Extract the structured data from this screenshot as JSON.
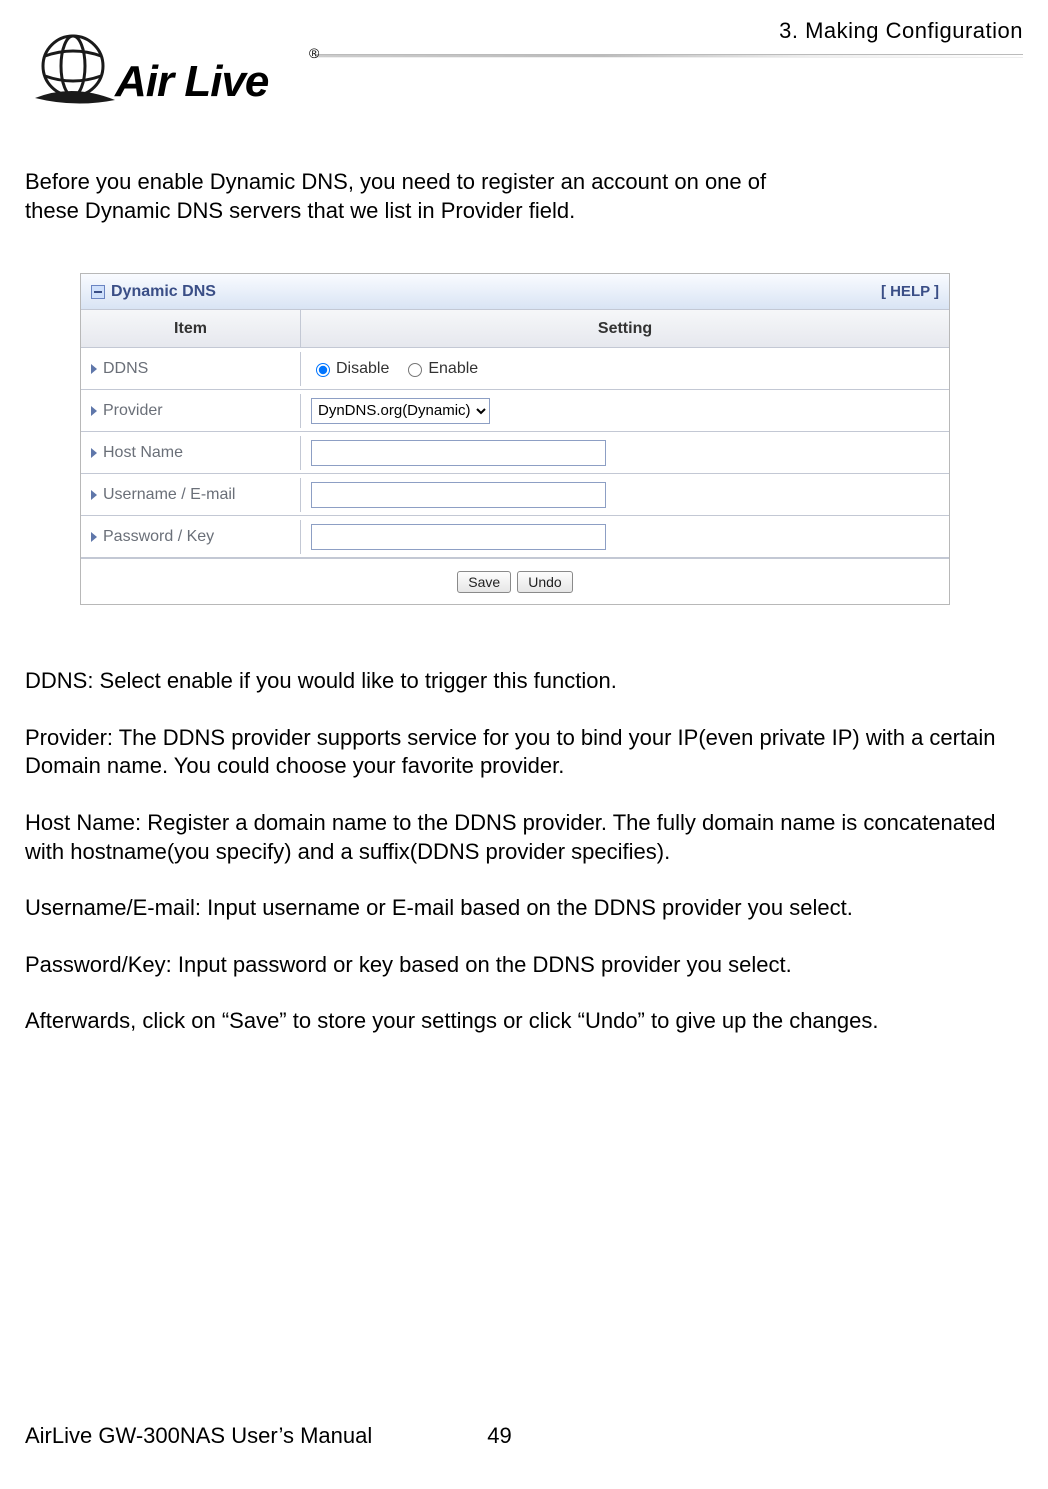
{
  "header": {
    "chapter": "3.  Making  Configuration",
    "brand_name": "Air Live",
    "brand_registered": "®"
  },
  "intro": "Before you enable Dynamic DNS, you need to register an account on one of these Dynamic DNS servers that we list in Provider field.",
  "panel": {
    "title": "Dynamic DNS",
    "help": "[ HELP ]",
    "col_item": "Item",
    "col_setting": "Setting",
    "rows": {
      "ddns_label": "DDNS",
      "ddns_disable": "Disable",
      "ddns_enable": "Enable",
      "provider_label": "Provider",
      "provider_value": "DynDNS.org(Dynamic)",
      "hostname_label": "Host Name",
      "hostname_value": "",
      "username_label": "Username / E-mail",
      "username_value": "",
      "password_label": "Password / Key",
      "password_value": ""
    },
    "buttons": {
      "save": "Save",
      "undo": "Undo"
    }
  },
  "descriptions": {
    "p1": "DDNS: Select enable if you would like to trigger this function.",
    "p2": "Provider: The DDNS provider supports service for you to bind your IP(even private IP) with a certain Domain name. You could choose your favorite provider.",
    "p3": "Host Name: Register a domain name to the DDNS provider. The fully domain name is concatenated with hostname(you specify) and a suffix(DDNS provider specifies).",
    "p4": "Username/E-mail: Input username or E-mail based on the DDNS provider you select.",
    "p5": "Password/Key: Input password or key based on the DDNS provider you select.",
    "p6": "Afterwards, click on “Save” to store your settings or click “Undo” to give up the changes."
  },
  "footer": {
    "manual": "AirLive GW-300NAS User’s Manual",
    "page": "49"
  }
}
